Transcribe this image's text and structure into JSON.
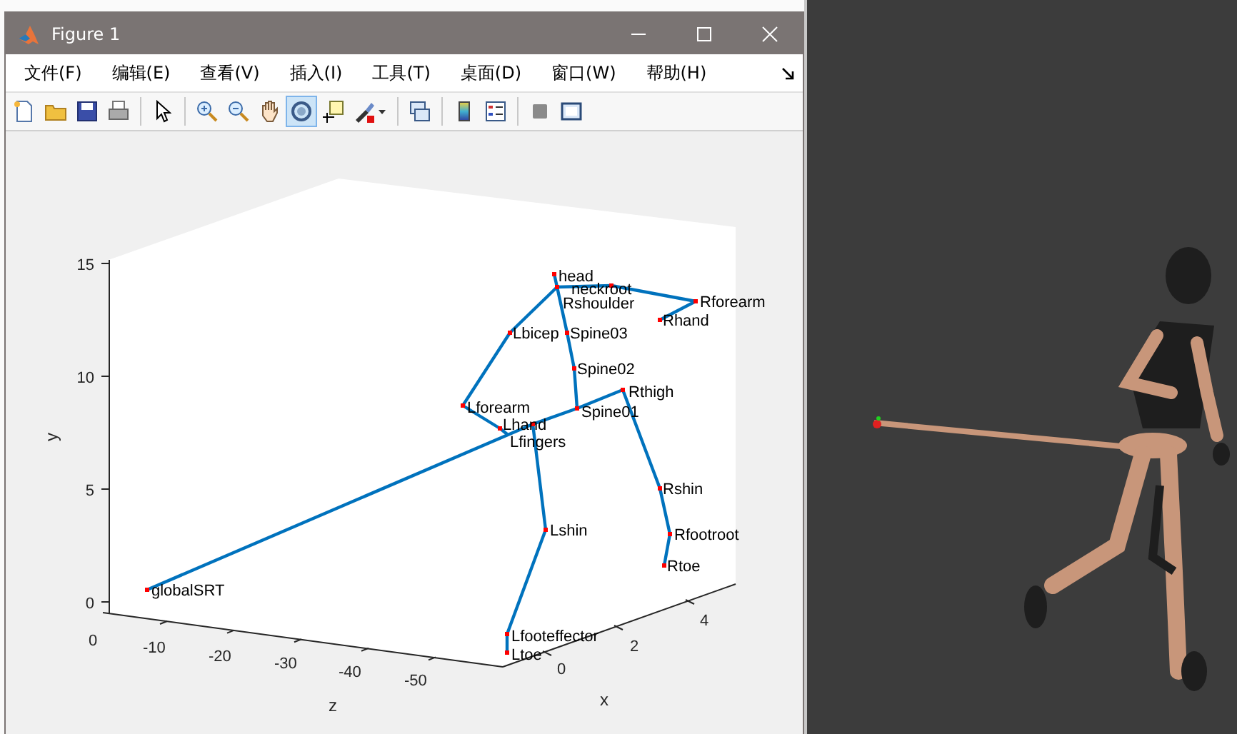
{
  "window": {
    "title": "Figure 1"
  },
  "menu": [
    "文件(F)",
    "编辑(E)",
    "查看(V)",
    "插入(I)",
    "工具(T)",
    "桌面(D)",
    "窗口(W)",
    "帮助(H)"
  ],
  "toolbar": [
    {
      "kind": "new",
      "selected": false
    },
    {
      "kind": "open",
      "selected": false
    },
    {
      "kind": "save",
      "selected": false
    },
    {
      "kind": "print",
      "selected": false
    },
    {
      "kind": "separator"
    },
    {
      "kind": "pointer",
      "selected": false
    },
    {
      "kind": "separator"
    },
    {
      "kind": "zoom-in",
      "selected": false
    },
    {
      "kind": "zoom-out",
      "selected": false
    },
    {
      "kind": "pan",
      "selected": false
    },
    {
      "kind": "rotate",
      "selected": true
    },
    {
      "kind": "datatip",
      "selected": false
    },
    {
      "kind": "brush",
      "selected": false
    },
    {
      "kind": "separator"
    },
    {
      "kind": "link",
      "selected": false
    },
    {
      "kind": "separator"
    },
    {
      "kind": "colorbar",
      "selected": false
    },
    {
      "kind": "legend",
      "selected": false
    },
    {
      "kind": "separator"
    },
    {
      "kind": "hide",
      "selected": false
    },
    {
      "kind": "property",
      "selected": false
    }
  ],
  "plot": {
    "joint_labels": [
      "head",
      "neckroot",
      "Rshoulder",
      "Rforearm",
      "Rhand",
      "Lbicep",
      "Spine03",
      "Spine02",
      "Lforearm",
      "Rthigh",
      "Spine01",
      "Lhand",
      "Lfingers",
      "Rshin",
      "Lshin",
      "Rfootroot",
      "Rtoe",
      "Lfooteffector",
      "Ltoe",
      "globalSRT"
    ],
    "y_ticks": [
      "15",
      "10",
      "5",
      "0"
    ],
    "z_ticks": [
      "0",
      "-10",
      "-20",
      "-30",
      "-40",
      "-50"
    ],
    "x_ticks": [
      "0",
      "2",
      "4"
    ],
    "xlabel": "x",
    "ylabel": "y",
    "zlabel": "z"
  }
}
